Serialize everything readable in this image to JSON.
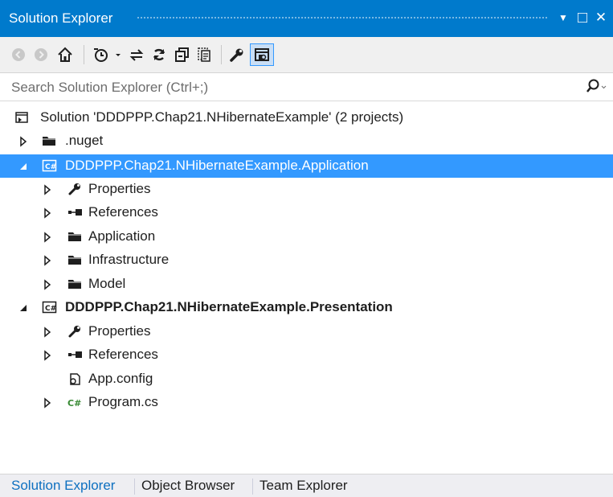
{
  "window": {
    "title": "Solution Explorer",
    "dropdown_glyph": "▼",
    "maximize_glyph": "□",
    "close_glyph": "✕"
  },
  "toolbar": {
    "icons": [
      "back-icon",
      "forward-icon",
      "home-icon",
      "pending-changes-icon",
      "dropdown-arrow-icon",
      "sync-icon",
      "refresh-icon",
      "collapse-all-icon",
      "show-all-files-icon",
      "properties-icon",
      "preview-icon"
    ]
  },
  "search": {
    "placeholder": "Search Solution Explorer (Ctrl+;)"
  },
  "tree": {
    "solution": "Solution 'DDDPPP.Chap21.NHibernateExample' (2 projects)",
    "nuget": ".nuget",
    "app_project": "DDDPPP.Chap21.NHibernateExample.Application",
    "app_properties": "Properties",
    "app_references": "References",
    "app_application": "Application",
    "app_infrastructure": "Infrastructure",
    "app_model": "Model",
    "pres_project": "DDDPPP.Chap21.NHibernateExample.Presentation",
    "pres_properties": "Properties",
    "pres_references": "References",
    "pres_appconfig": "App.config",
    "pres_program": "Program.cs"
  },
  "bottom_tabs": {
    "solution_explorer": "Solution Explorer",
    "object_browser": "Object Browser",
    "team_explorer": "Team Explorer"
  },
  "colors": {
    "accent": "#007acc",
    "selection": "#3399ff",
    "active_tab_text": "#0e70c0"
  }
}
